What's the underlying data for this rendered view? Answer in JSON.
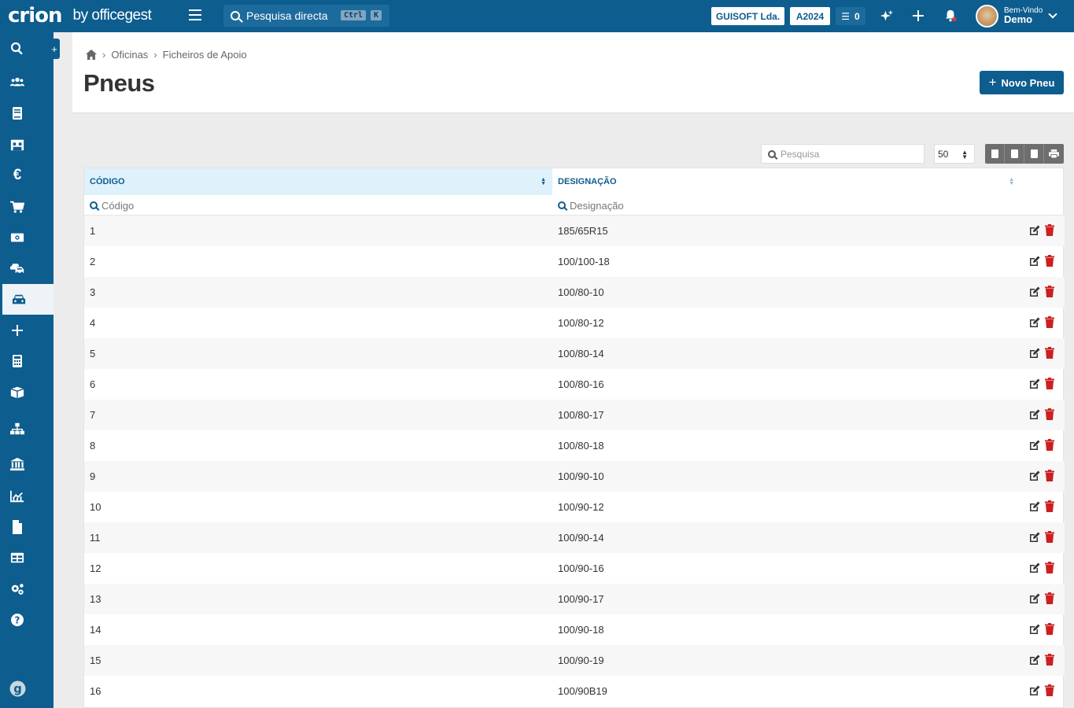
{
  "app": {
    "logo": "crion",
    "logo_suffix": "by officegest",
    "search_placeholder": "Pesquisa directa",
    "kbd_ctrl": "Ctrl",
    "kbd_k": "K",
    "company": "GUISOFT Lda.",
    "year": "A2024",
    "tasks_count": "0",
    "user_greeting": "Bem-Vindo",
    "user_name": "Demo"
  },
  "sidebar": {
    "items": [
      {
        "icon": "search-icon"
      },
      {
        "icon": "users-icon"
      },
      {
        "icon": "book-icon"
      },
      {
        "icon": "warehouse-icon"
      },
      {
        "icon": "euro-icon"
      },
      {
        "icon": "cart-icon"
      },
      {
        "icon": "money-icon"
      },
      {
        "icon": "vehicles-icon"
      },
      {
        "icon": "car-icon",
        "active": true
      },
      {
        "icon": "plus-icon"
      },
      {
        "icon": "calculator-icon"
      },
      {
        "icon": "box-icon"
      },
      {
        "icon": "sitemap-icon"
      },
      {
        "icon": "bank-icon"
      },
      {
        "icon": "chart-icon"
      },
      {
        "icon": "file-icon"
      },
      {
        "icon": "table-icon"
      },
      {
        "icon": "cogs-icon"
      },
      {
        "icon": "help-icon"
      },
      {
        "icon": "officegest-icon"
      }
    ]
  },
  "breadcrumb": {
    "items": [
      "Oficinas",
      "Ficheiros de Apoio"
    ]
  },
  "page": {
    "title": "Pneus",
    "new_button": "Novo Pneu"
  },
  "table_tools": {
    "search_placeholder": "Pesquisa",
    "page_size": "50"
  },
  "table": {
    "columns": [
      "CÓDIGO",
      "DESIGNAÇÃO"
    ],
    "filter_placeholders": [
      "Código",
      "Designação"
    ],
    "rows": [
      {
        "code": "1",
        "designation": "185/65R15"
      },
      {
        "code": "2",
        "designation": "100/100-18"
      },
      {
        "code": "3",
        "designation": "100/80-10"
      },
      {
        "code": "4",
        "designation": "100/80-12"
      },
      {
        "code": "5",
        "designation": "100/80-14"
      },
      {
        "code": "6",
        "designation": "100/80-16"
      },
      {
        "code": "7",
        "designation": "100/80-17"
      },
      {
        "code": "8",
        "designation": "100/80-18"
      },
      {
        "code": "9",
        "designation": "100/90-10"
      },
      {
        "code": "10",
        "designation": "100/90-12"
      },
      {
        "code": "11",
        "designation": "100/90-14"
      },
      {
        "code": "12",
        "designation": "100/90-16"
      },
      {
        "code": "13",
        "designation": "100/90-17"
      },
      {
        "code": "14",
        "designation": "100/90-18"
      },
      {
        "code": "15",
        "designation": "100/90-19"
      },
      {
        "code": "16",
        "designation": "100/90B19"
      }
    ]
  },
  "colors": {
    "brand": "#0d5d8f",
    "delete": "#cc1f1f"
  }
}
